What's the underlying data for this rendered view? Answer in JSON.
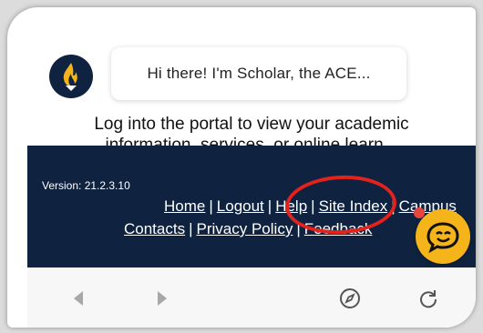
{
  "chat": {
    "greeting": "Hi there! I'm Scholar, the ACE..."
  },
  "intro": {
    "line1": "Log into the portal to view your academic",
    "line2": "information, services, or online learn..."
  },
  "footer": {
    "version": "Version: 21.2.3.10",
    "links_row1": [
      "Home",
      "Logout",
      "Help",
      "Site Index",
      "Campus"
    ],
    "links_row2": [
      "Contacts",
      "Privacy Policy",
      "Feedback"
    ]
  },
  "toolbar": {
    "icons": [
      "back-icon",
      "forward-icon",
      "compass-icon",
      "reload-icon"
    ]
  },
  "colors": {
    "footer_bg": "#0f2340",
    "highlight": "#e3211d",
    "chat_fab": "#f4b41a"
  }
}
